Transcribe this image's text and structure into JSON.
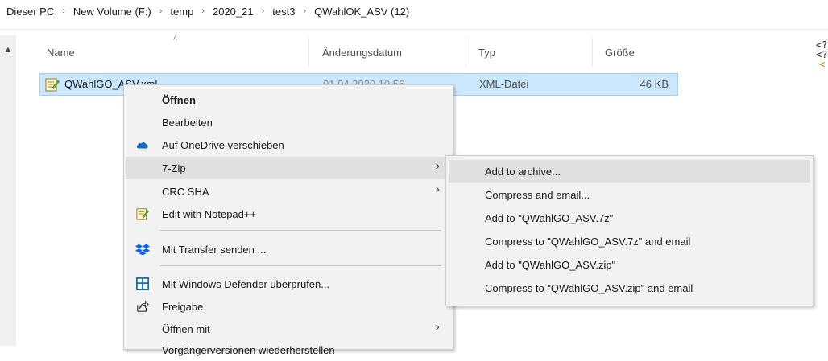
{
  "breadcrumb": [
    "Dieser PC",
    "New Volume (F:)",
    "temp",
    "2020_21",
    "test3",
    "QWahlOK_ASV (12)"
  ],
  "columns": {
    "name": "Name",
    "date": "Änderungsdatum",
    "type": "Typ",
    "size": "Größe"
  },
  "file": {
    "name": "QWahlGO_ASV.xml",
    "date": "01.04.2020 10:56",
    "type": "XML-Datei",
    "size": "46 KB"
  },
  "right_preview": [
    "<?",
    "<?",
    "<"
  ],
  "context_menu": {
    "items": [
      {
        "label": "Öffnen"
      },
      {
        "label": "Bearbeiten"
      },
      {
        "label": "Auf OneDrive verschieben",
        "icon": "onedrive-cloud-icon"
      },
      {
        "label": "7-Zip"
      },
      {
        "label": "CRC SHA"
      },
      {
        "label": "Edit with Notepad++",
        "icon": "notepad-plus-plus-icon"
      },
      {
        "label": "Mit Transfer senden ...",
        "icon": "dropbox-icon"
      },
      {
        "label": "Mit Windows Defender überprüfen...",
        "icon": "windows-defender-icon"
      },
      {
        "label": "Freigabe",
        "icon": "share-icon"
      },
      {
        "label": "Öffnen mit"
      },
      {
        "label": "Vorgängerversionen wiederherstellen"
      }
    ]
  },
  "submenu_7zip": {
    "items": [
      {
        "label": "Add to archive..."
      },
      {
        "label": "Compress and email..."
      },
      {
        "label": "Add to \"QWahlGO_ASV.7z\""
      },
      {
        "label": "Compress to \"QWahlGO_ASV.7z\" and email"
      },
      {
        "label": "Add to \"QWahlGO_ASV.zip\""
      },
      {
        "label": "Compress to \"QWahlGO_ASV.zip\" and email"
      }
    ]
  },
  "colors": {
    "selection_bg": "#cce8ff",
    "selection_border": "#99d1ff",
    "menu_bg": "#f2f2f2",
    "menu_hover": "#e0e0e0",
    "onedrive_blue": "#0f6cbd"
  }
}
